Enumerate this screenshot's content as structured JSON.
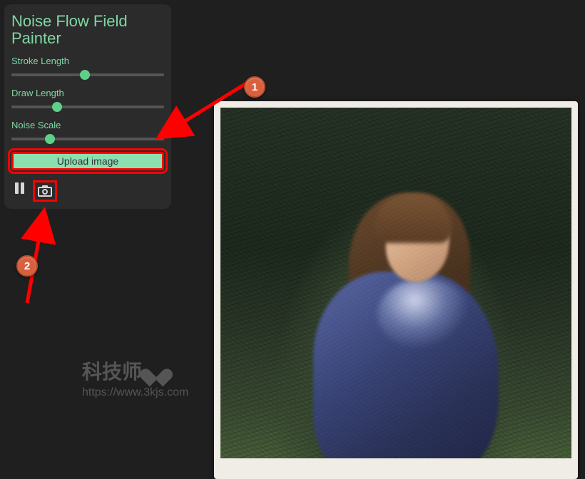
{
  "panel": {
    "title": "Noise Flow Field Painter",
    "sliders": [
      {
        "label": "Stroke Length",
        "value_pct": 48
      },
      {
        "label": "Draw Length",
        "value_pct": 30
      },
      {
        "label": "Noise Scale",
        "value_pct": 25
      }
    ],
    "upload_label": "Upload image"
  },
  "annotations": {
    "badge1": "1",
    "badge2": "2"
  },
  "watermark": {
    "title": "科技师",
    "url": "https://www.3kjs.com"
  }
}
